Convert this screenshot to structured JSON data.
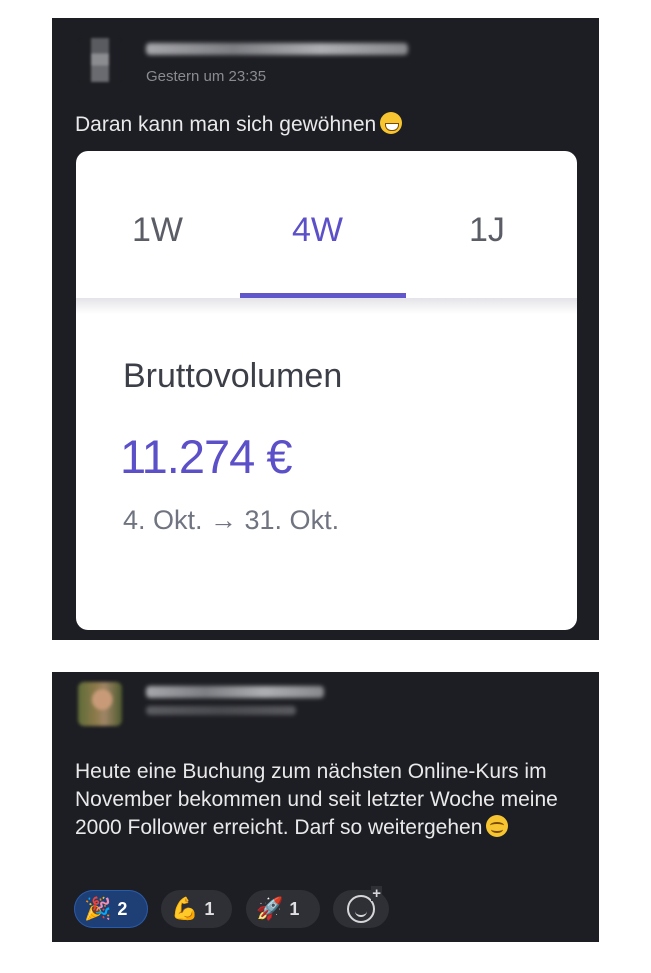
{
  "post1": {
    "timestamp": "Gestern um 23:35",
    "message": "Daran kann man sich gewöhnen",
    "message_emoji": "grinning-face-with-smiling-eyes",
    "card": {
      "tabs": [
        {
          "label": "1W",
          "active": false
        },
        {
          "label": "4W",
          "active": true
        },
        {
          "label": "1J",
          "active": false
        }
      ],
      "metric_label": "Bruttovolumen",
      "metric_value": "11.274 €",
      "date_range": "4. Okt. → 31. Okt."
    }
  },
  "post2": {
    "message": "Heute eine Buchung zum nächsten Online-Kurs im November bekommen und seit letzter Woche meine 2000 Follower erreicht. Darf so weitergehen",
    "message_emoji": "smiling-face-with-smiling-eyes",
    "reactions": [
      {
        "icon": "party-popper",
        "glyph": "🎉",
        "count": "2",
        "selected": true
      },
      {
        "icon": "flexed-biceps",
        "glyph": "💪",
        "count": "1",
        "selected": false
      },
      {
        "icon": "rocket",
        "glyph": "🚀",
        "count": "1",
        "selected": false
      }
    ],
    "add_reaction_icon": "add-reaction-icon"
  },
  "colors": {
    "post_background": "#1d1e23",
    "accent_purple": "#5b50c8",
    "selected_reaction": "#1e3f75"
  }
}
